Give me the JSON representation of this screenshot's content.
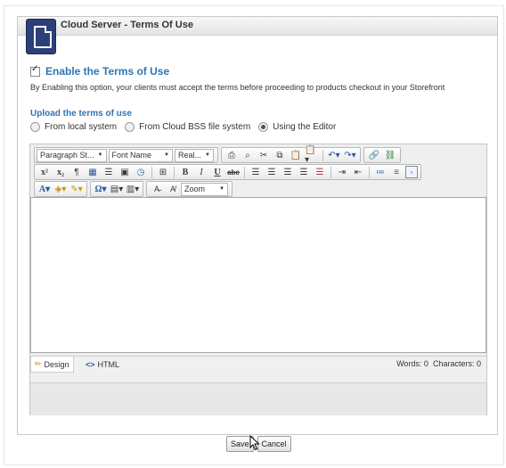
{
  "window": {
    "title": "Cloud Server - Terms Of Use"
  },
  "enable": {
    "checked": true,
    "label": "Enable the Terms of Use"
  },
  "description": "By Enabling this option, your clients must accept the terms before proceeding to products checkout in your Storefront",
  "upload": {
    "title": "Upload the terms of use",
    "options": [
      "From local system",
      "From Cloud BSS file system",
      "Using the Editor"
    ],
    "selected": "Using the Editor"
  },
  "toolbar": {
    "paragraph_style": "Paragraph St...",
    "font_name": "Font Name",
    "font_size": "Real...",
    "zoom": "Zoom",
    "superscript": "x²",
    "subscript": "x₂",
    "bold": "B",
    "italic": "I",
    "underline": "U",
    "strike": "abc",
    "omega": "Ω",
    "font_color": "A"
  },
  "status": {
    "design_label": "Design",
    "html_label": "HTML",
    "word_count": "Words: 0",
    "char_count": "Characters: 0"
  },
  "buttons": {
    "save": "Save",
    "cancel": "Cancel"
  },
  "colors": {
    "accent": "#2e75b6",
    "icon_bg": "#2d3f7a"
  }
}
